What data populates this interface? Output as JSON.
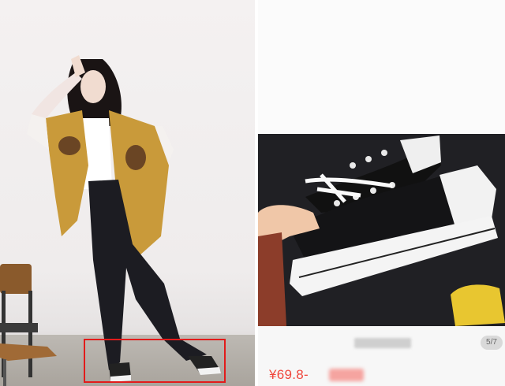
{
  "left_photo": {
    "description_icon": "fashion-photo",
    "highlight_color": "#e21b1b"
  },
  "product": {
    "page_indicator": "5/7",
    "price": "¥69.8-",
    "price_color": "#f0463c"
  }
}
